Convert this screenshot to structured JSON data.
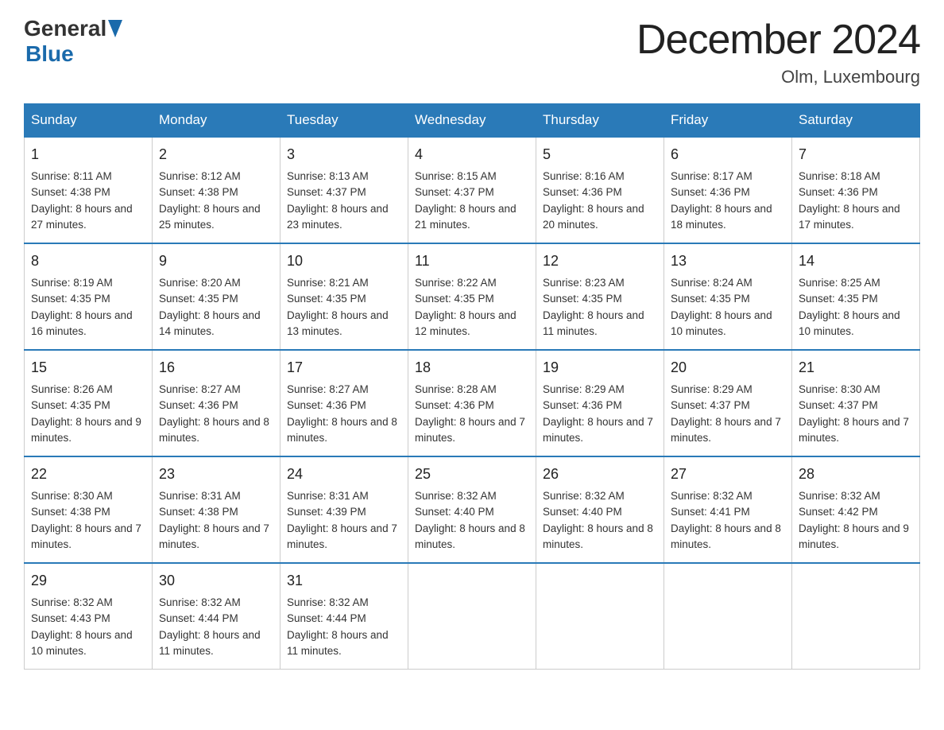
{
  "logo": {
    "general": "General",
    "blue": "Blue"
  },
  "title": "December 2024",
  "location": "Olm, Luxembourg",
  "days_of_week": [
    "Sunday",
    "Monday",
    "Tuesday",
    "Wednesday",
    "Thursday",
    "Friday",
    "Saturday"
  ],
  "weeks": [
    [
      {
        "day": "1",
        "sunrise": "8:11 AM",
        "sunset": "4:38 PM",
        "daylight": "8 hours and 27 minutes."
      },
      {
        "day": "2",
        "sunrise": "8:12 AM",
        "sunset": "4:38 PM",
        "daylight": "8 hours and 25 minutes."
      },
      {
        "day": "3",
        "sunrise": "8:13 AM",
        "sunset": "4:37 PM",
        "daylight": "8 hours and 23 minutes."
      },
      {
        "day": "4",
        "sunrise": "8:15 AM",
        "sunset": "4:37 PM",
        "daylight": "8 hours and 21 minutes."
      },
      {
        "day": "5",
        "sunrise": "8:16 AM",
        "sunset": "4:36 PM",
        "daylight": "8 hours and 20 minutes."
      },
      {
        "day": "6",
        "sunrise": "8:17 AM",
        "sunset": "4:36 PM",
        "daylight": "8 hours and 18 minutes."
      },
      {
        "day": "7",
        "sunrise": "8:18 AM",
        "sunset": "4:36 PM",
        "daylight": "8 hours and 17 minutes."
      }
    ],
    [
      {
        "day": "8",
        "sunrise": "8:19 AM",
        "sunset": "4:35 PM",
        "daylight": "8 hours and 16 minutes."
      },
      {
        "day": "9",
        "sunrise": "8:20 AM",
        "sunset": "4:35 PM",
        "daylight": "8 hours and 14 minutes."
      },
      {
        "day": "10",
        "sunrise": "8:21 AM",
        "sunset": "4:35 PM",
        "daylight": "8 hours and 13 minutes."
      },
      {
        "day": "11",
        "sunrise": "8:22 AM",
        "sunset": "4:35 PM",
        "daylight": "8 hours and 12 minutes."
      },
      {
        "day": "12",
        "sunrise": "8:23 AM",
        "sunset": "4:35 PM",
        "daylight": "8 hours and 11 minutes."
      },
      {
        "day": "13",
        "sunrise": "8:24 AM",
        "sunset": "4:35 PM",
        "daylight": "8 hours and 10 minutes."
      },
      {
        "day": "14",
        "sunrise": "8:25 AM",
        "sunset": "4:35 PM",
        "daylight": "8 hours and 10 minutes."
      }
    ],
    [
      {
        "day": "15",
        "sunrise": "8:26 AM",
        "sunset": "4:35 PM",
        "daylight": "8 hours and 9 minutes."
      },
      {
        "day": "16",
        "sunrise": "8:27 AM",
        "sunset": "4:36 PM",
        "daylight": "8 hours and 8 minutes."
      },
      {
        "day": "17",
        "sunrise": "8:27 AM",
        "sunset": "4:36 PM",
        "daylight": "8 hours and 8 minutes."
      },
      {
        "day": "18",
        "sunrise": "8:28 AM",
        "sunset": "4:36 PM",
        "daylight": "8 hours and 7 minutes."
      },
      {
        "day": "19",
        "sunrise": "8:29 AM",
        "sunset": "4:36 PM",
        "daylight": "8 hours and 7 minutes."
      },
      {
        "day": "20",
        "sunrise": "8:29 AM",
        "sunset": "4:37 PM",
        "daylight": "8 hours and 7 minutes."
      },
      {
        "day": "21",
        "sunrise": "8:30 AM",
        "sunset": "4:37 PM",
        "daylight": "8 hours and 7 minutes."
      }
    ],
    [
      {
        "day": "22",
        "sunrise": "8:30 AM",
        "sunset": "4:38 PM",
        "daylight": "8 hours and 7 minutes."
      },
      {
        "day": "23",
        "sunrise": "8:31 AM",
        "sunset": "4:38 PM",
        "daylight": "8 hours and 7 minutes."
      },
      {
        "day": "24",
        "sunrise": "8:31 AM",
        "sunset": "4:39 PM",
        "daylight": "8 hours and 7 minutes."
      },
      {
        "day": "25",
        "sunrise": "8:32 AM",
        "sunset": "4:40 PM",
        "daylight": "8 hours and 8 minutes."
      },
      {
        "day": "26",
        "sunrise": "8:32 AM",
        "sunset": "4:40 PM",
        "daylight": "8 hours and 8 minutes."
      },
      {
        "day": "27",
        "sunrise": "8:32 AM",
        "sunset": "4:41 PM",
        "daylight": "8 hours and 8 minutes."
      },
      {
        "day": "28",
        "sunrise": "8:32 AM",
        "sunset": "4:42 PM",
        "daylight": "8 hours and 9 minutes."
      }
    ],
    [
      {
        "day": "29",
        "sunrise": "8:32 AM",
        "sunset": "4:43 PM",
        "daylight": "8 hours and 10 minutes."
      },
      {
        "day": "30",
        "sunrise": "8:32 AM",
        "sunset": "4:44 PM",
        "daylight": "8 hours and 11 minutes."
      },
      {
        "day": "31",
        "sunrise": "8:32 AM",
        "sunset": "4:44 PM",
        "daylight": "8 hours and 11 minutes."
      },
      null,
      null,
      null,
      null
    ]
  ],
  "labels": {
    "sunrise": "Sunrise:",
    "sunset": "Sunset:",
    "daylight": "Daylight:"
  }
}
